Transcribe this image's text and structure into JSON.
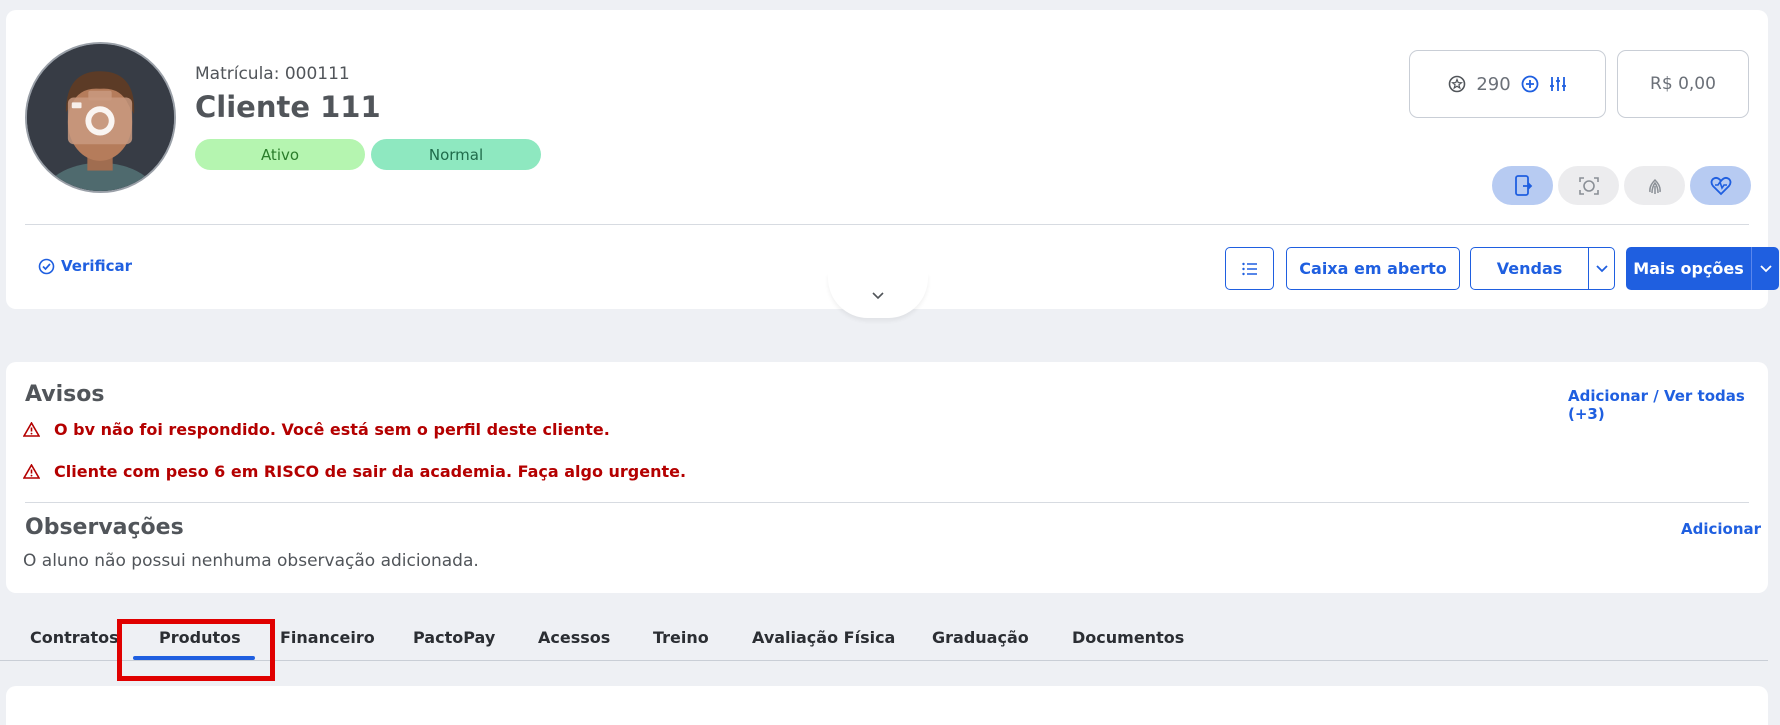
{
  "profile": {
    "matricula": "Matrícula: 000111",
    "name": "Cliente 111",
    "status_badge": "Ativo",
    "risk_badge": "Normal",
    "points": "290",
    "balance": "R$ 0,00"
  },
  "actions": {
    "verificar": "Verificar",
    "caixa_em_aberto": "Caixa em aberto",
    "vendas": "Vendas",
    "mais_opcoes": "Mais opções"
  },
  "avisos": {
    "title": "Avisos",
    "link": "Adicionar / Ver todas (+3)",
    "items": [
      "O bv não foi respondido. Você está sem o perfil deste cliente.",
      "Cliente com peso 6 em RISCO de sair da academia. Faça algo urgente."
    ]
  },
  "observacoes": {
    "title": "Observações",
    "link": "Adicionar",
    "empty_text": "O aluno não possui nenhuma observação adicionada."
  },
  "tabs": [
    {
      "label": "Contratos"
    },
    {
      "label": "Produtos",
      "active": true
    },
    {
      "label": "Financeiro"
    },
    {
      "label": "PactoPay"
    },
    {
      "label": "Acessos"
    },
    {
      "label": "Treino"
    },
    {
      "label": "Avaliação Física"
    },
    {
      "label": "Graduação"
    },
    {
      "label": "Documentos"
    }
  ],
  "colors": {
    "primary": "#1f5fe0",
    "danger": "#b40000",
    "highlight": "#e00000",
    "ativo_bg": "#b5f5b0",
    "normal_bg": "#8ee8c0"
  },
  "icons": {
    "points": "coin-icon",
    "add_points": "plus-circle-icon",
    "adjust": "sliders-icon",
    "pill_1": "mobile-device-icon",
    "pill_2": "face-scan-icon",
    "pill_3": "fingerprint-icon",
    "pill_4": "heart-pulse-icon",
    "list": "list-icon",
    "verify": "check-circle-icon",
    "collapse": "chevron-down-icon",
    "warning": "warning-triangle-icon"
  }
}
